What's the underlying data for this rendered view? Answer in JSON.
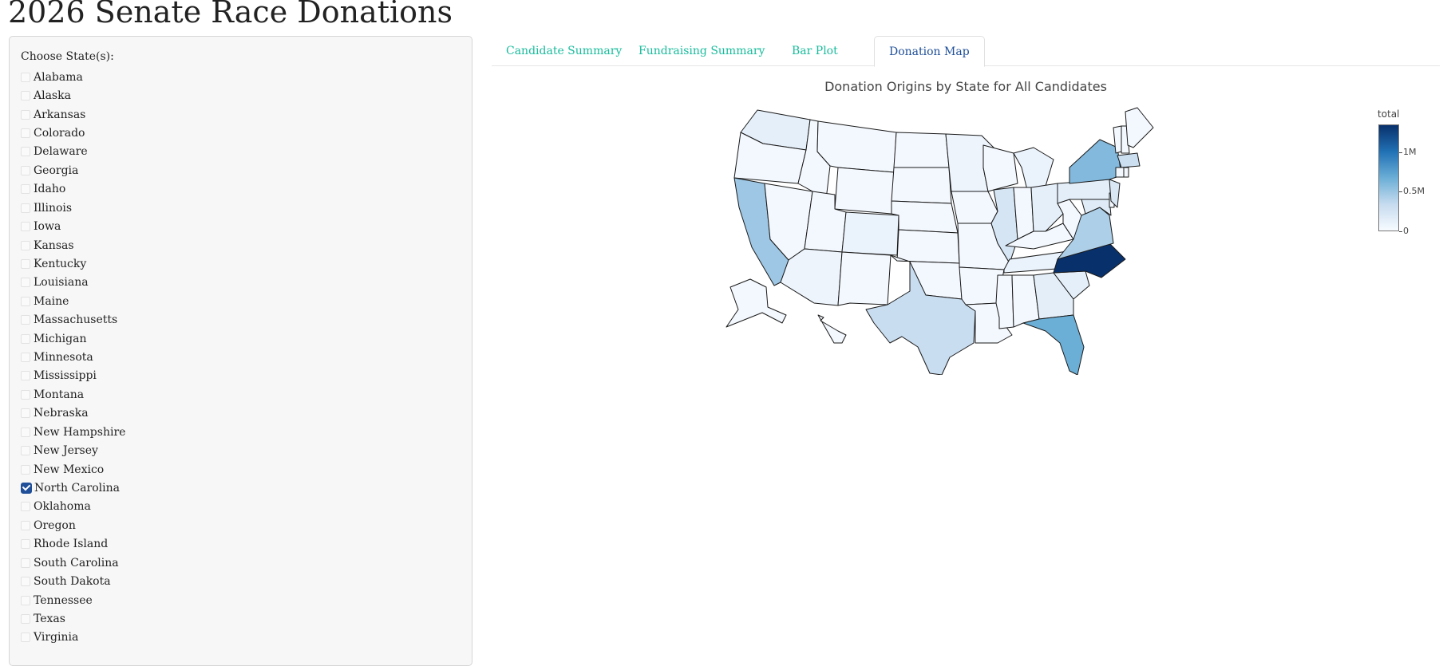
{
  "app": {
    "title": "2026 Senate Race Donations"
  },
  "sidebar": {
    "label": "Choose State(s):",
    "states": [
      {
        "label": "Alabama",
        "checked": false
      },
      {
        "label": "Alaska",
        "checked": false
      },
      {
        "label": "Arkansas",
        "checked": false
      },
      {
        "label": "Colorado",
        "checked": false
      },
      {
        "label": "Delaware",
        "checked": false
      },
      {
        "label": "Georgia",
        "checked": false
      },
      {
        "label": "Idaho",
        "checked": false
      },
      {
        "label": "Illinois",
        "checked": false
      },
      {
        "label": "Iowa",
        "checked": false
      },
      {
        "label": "Kansas",
        "checked": false
      },
      {
        "label": "Kentucky",
        "checked": false
      },
      {
        "label": "Louisiana",
        "checked": false
      },
      {
        "label": "Maine",
        "checked": false
      },
      {
        "label": "Massachusetts",
        "checked": false
      },
      {
        "label": "Michigan",
        "checked": false
      },
      {
        "label": "Minnesota",
        "checked": false
      },
      {
        "label": "Mississippi",
        "checked": false
      },
      {
        "label": "Montana",
        "checked": false
      },
      {
        "label": "Nebraska",
        "checked": false
      },
      {
        "label": "New Hampshire",
        "checked": false
      },
      {
        "label": "New Jersey",
        "checked": false
      },
      {
        "label": "New Mexico",
        "checked": false
      },
      {
        "label": "North Carolina",
        "checked": true
      },
      {
        "label": "Oklahoma",
        "checked": false
      },
      {
        "label": "Oregon",
        "checked": false
      },
      {
        "label": "Rhode Island",
        "checked": false
      },
      {
        "label": "South Carolina",
        "checked": false
      },
      {
        "label": "South Dakota",
        "checked": false
      },
      {
        "label": "Tennessee",
        "checked": false
      },
      {
        "label": "Texas",
        "checked": false
      },
      {
        "label": "Virginia",
        "checked": false
      }
    ]
  },
  "tabs": [
    {
      "label": "Candidate Summary",
      "active": false
    },
    {
      "label": "Fundraising Summary",
      "active": false
    },
    {
      "label": "Bar Plot",
      "active": false
    },
    {
      "label": "Donation Map",
      "active": true
    }
  ],
  "colors": {
    "accent": "#18bc9c",
    "active_tab": "#1f4f98",
    "checkbox": "#1f4f98"
  },
  "chart_data": {
    "type": "choropleth",
    "title": "Donation Origins by State for All Candidates",
    "colorbar": {
      "title": "total",
      "range": [
        0,
        1350000
      ],
      "ticks": [
        {
          "value": 0,
          "label": "0"
        },
        {
          "value": 500000,
          "label": "0.5M"
        },
        {
          "value": 1000000,
          "label": "1M"
        }
      ]
    },
    "colorscale": "Blues",
    "states": [
      {
        "state": "North Carolina",
        "total": 1350000
      },
      {
        "state": "Florida",
        "total": 420000
      },
      {
        "state": "New York",
        "total": 340000
      },
      {
        "state": "California",
        "total": 250000
      },
      {
        "state": "Virginia",
        "total": 200000
      },
      {
        "state": "Texas",
        "total": 120000
      },
      {
        "state": "Illinois",
        "total": 70000
      },
      {
        "state": "Massachusetts",
        "total": 110000
      },
      {
        "state": "New Jersey",
        "total": 60000
      },
      {
        "state": "Georgia",
        "total": 30000
      },
      {
        "state": "South Carolina",
        "total": 25000
      },
      {
        "state": "Ohio",
        "total": 25000
      },
      {
        "state": "Pennsylvania",
        "total": 30000
      },
      {
        "state": "Maryland",
        "total": 40000
      },
      {
        "state": "Washington",
        "total": 25000
      },
      {
        "state": "Colorado",
        "total": 15000
      },
      {
        "state": "Tennessee",
        "total": 15000
      },
      {
        "state": "Michigan",
        "total": 15000
      },
      {
        "state": "Arizona",
        "total": 10000
      },
      {
        "state": "Minnesota",
        "total": 10000
      }
    ]
  }
}
